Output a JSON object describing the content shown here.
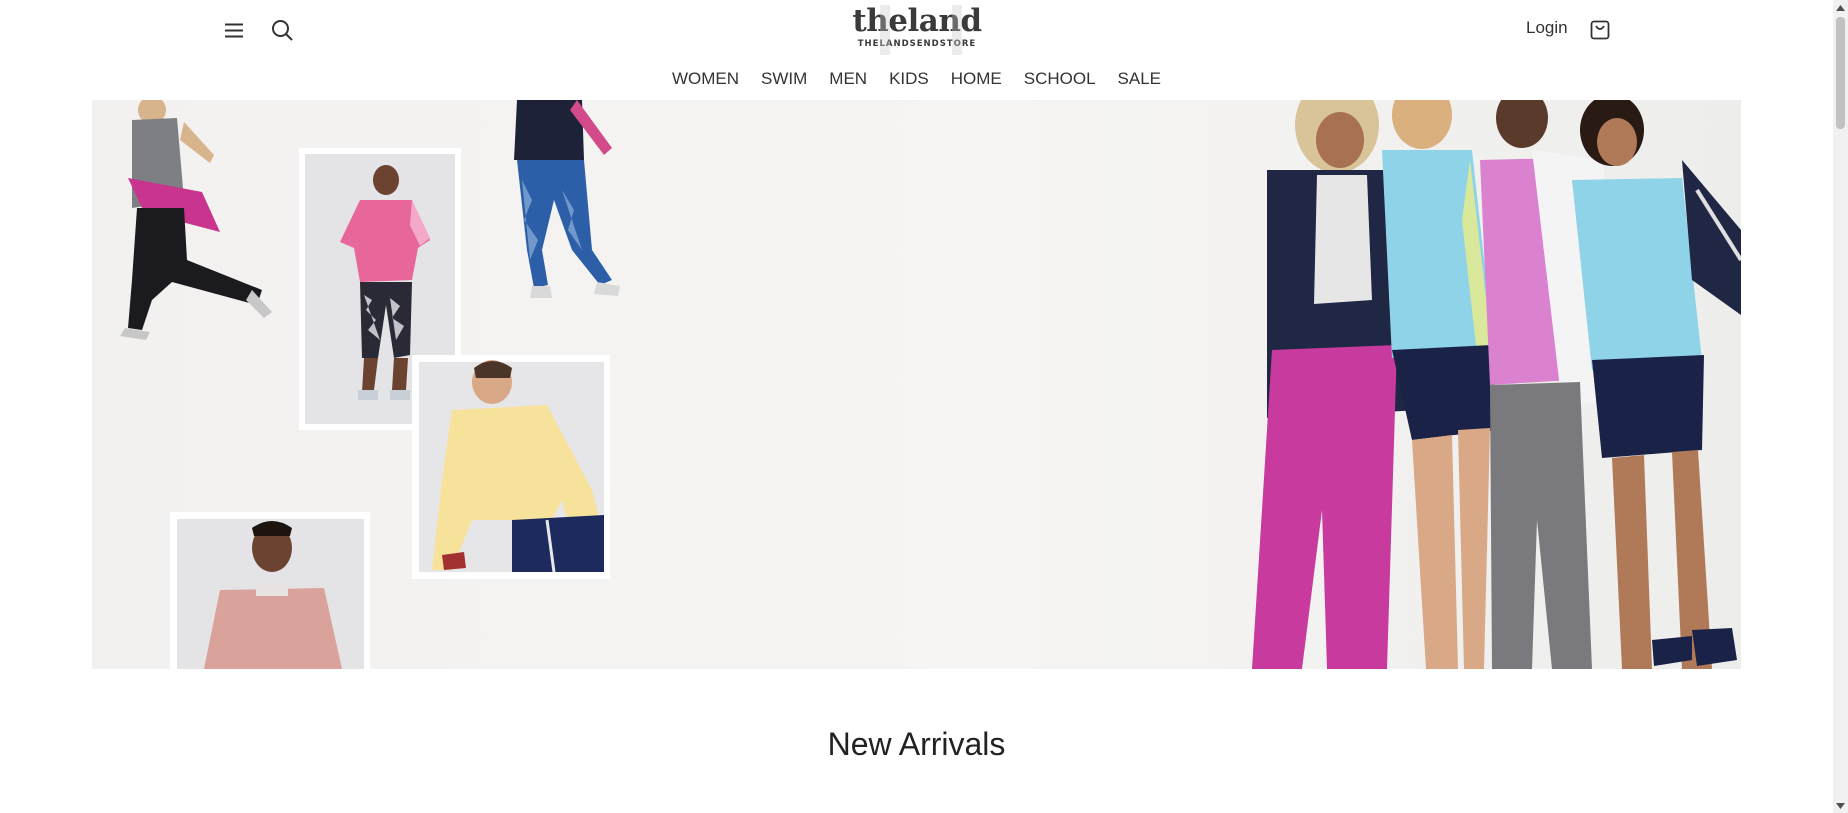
{
  "header": {
    "logo_word": "theland",
    "logo_sub": "THELANDSENDSTORE",
    "login_label": "Login"
  },
  "nav": {
    "items": [
      "WOMEN",
      "SWIM",
      "MEN",
      "KIDS",
      "HOME",
      "SCHOOL",
      "SALE"
    ]
  },
  "hero": {
    "image": "apparel-collage-banner"
  },
  "section": {
    "title": "New Arrivals"
  },
  "icons": {
    "menu": "hamburger-menu-icon",
    "search": "search-icon",
    "cart": "shopping-bag-icon"
  },
  "colors": {
    "text": "#333333",
    "hero_bg": "#f4f2f0",
    "pink": "#c93a9f",
    "navy": "#1d2645",
    "sky": "#8fd3e8"
  }
}
